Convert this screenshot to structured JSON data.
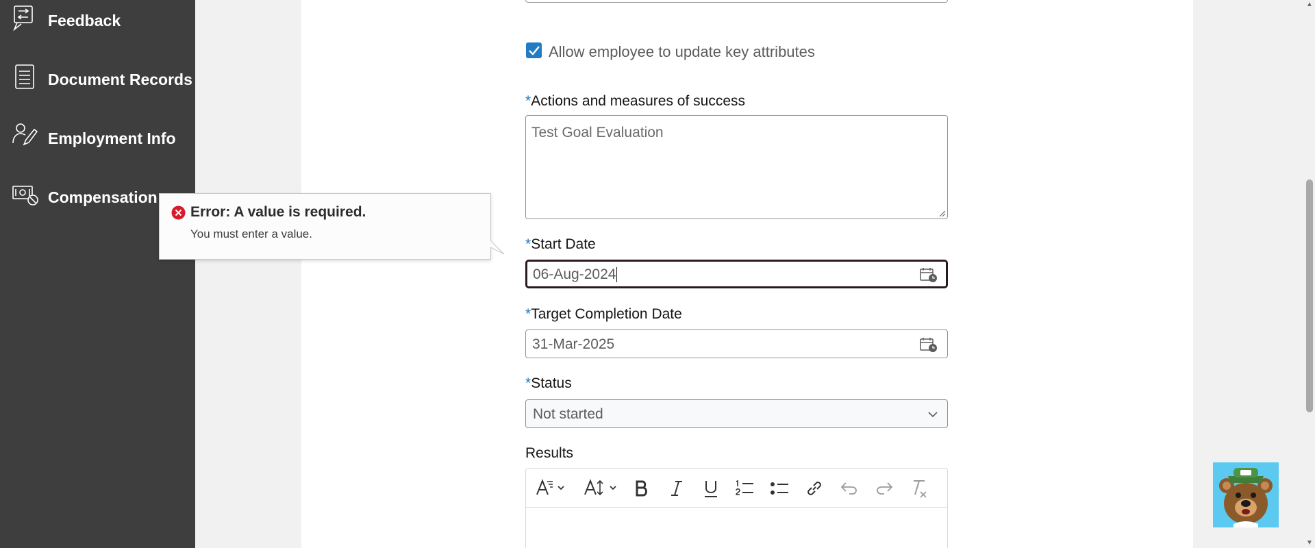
{
  "sidebar": {
    "items": [
      {
        "label": "Feedback",
        "icon": "feedback-icon"
      },
      {
        "label": "Document Records",
        "icon": "document-icon"
      },
      {
        "label": "Employment Info",
        "icon": "person-edit-icon"
      },
      {
        "label": "Compensation",
        "icon": "money-icon"
      }
    ]
  },
  "form": {
    "allow_update_label": "Allow employee to update key attributes",
    "allow_update_checked": true,
    "actions_label": "Actions and measures of success",
    "actions_value": "Test Goal Evaluation",
    "start_date_label": "Start Date",
    "start_date_value": "06-Aug-2024",
    "target_date_label": "Target Completion Date",
    "target_date_value": "31-Mar-2025",
    "status_label": "Status",
    "status_value": "Not started",
    "results_label": "Results",
    "required_mark": "*"
  },
  "error": {
    "title": "Error: A value is required.",
    "message": "You must enter a value."
  },
  "colors": {
    "sidebar_bg": "#3e3e3e",
    "accent": "#227bc3",
    "error_red": "#d81b2b",
    "mascot_bg": "#5bc9f0"
  }
}
